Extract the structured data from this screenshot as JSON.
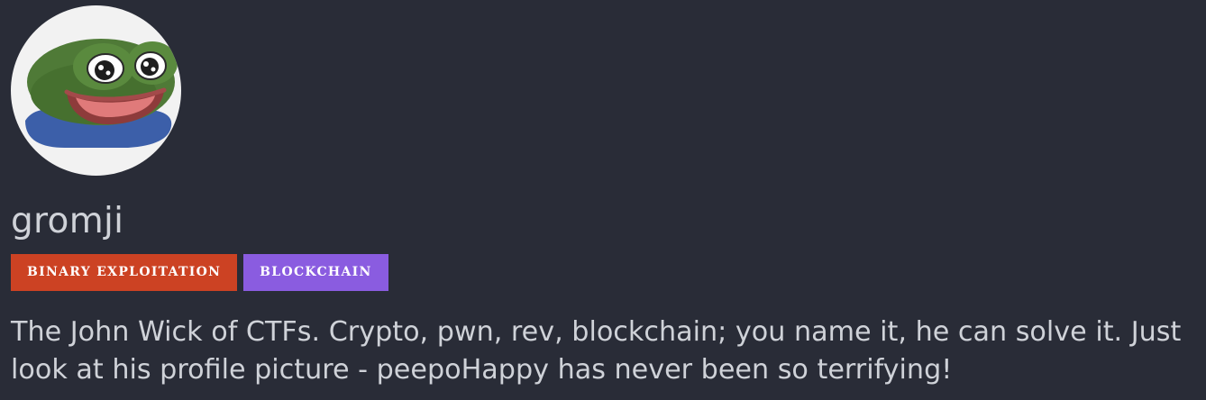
{
  "profile": {
    "username": "gromji",
    "avatar_icon": "peepo-happy-frog-avatar",
    "tags": [
      {
        "label": "BINARY EXPLOITATION",
        "color": "#cc4223"
      },
      {
        "label": "BLOCKCHAIN",
        "color": "#8a5ce0"
      }
    ],
    "bio": "The John Wick of CTFs. Crypto, pwn, rev, blockchain; you name it, he can solve it. Just look at his profile picture - peepoHappy has never been so terrifying!"
  },
  "colors": {
    "background": "#292c37",
    "text": "#cfd2d8",
    "avatar_bg": "#f2f2f2"
  }
}
